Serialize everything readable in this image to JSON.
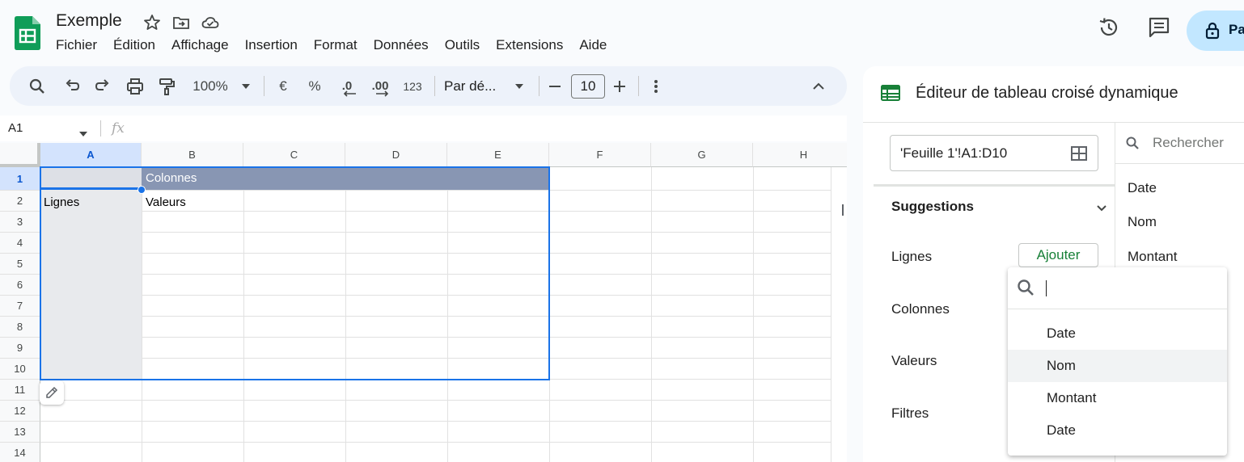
{
  "app": {
    "doc_title": "Exemple",
    "brand_color": "#0f9d58"
  },
  "menu": [
    "Fichier",
    "Édition",
    "Affichage",
    "Insertion",
    "Format",
    "Données",
    "Outils",
    "Extensions",
    "Aide"
  ],
  "header": {
    "share_label": "Pa"
  },
  "toolbar": {
    "zoom": "100%",
    "currency": "€",
    "percent": "%",
    "dec_decrease": ".0",
    "dec_increase": ".00",
    "number_format": "123",
    "font": "Par dé...",
    "font_size": "10"
  },
  "formula_bar": {
    "cell_ref": "A1",
    "fx": "fx",
    "value": ""
  },
  "grid": {
    "columns": [
      "A",
      "B",
      "C",
      "D",
      "E",
      "F",
      "G",
      "H"
    ],
    "rows": [
      "1",
      "2",
      "3",
      "4",
      "5",
      "6",
      "7",
      "8",
      "9",
      "10",
      "11",
      "12",
      "13",
      "14"
    ],
    "selected_column": "A",
    "selected_row": "1",
    "cells": {
      "B1": "Colonnes",
      "A2": "Lignes",
      "B2": "Valeurs"
    }
  },
  "panel": {
    "title": "Éditeur de tableau croisé dynamique",
    "range": "'Feuille 1'!A1:D10",
    "sections": {
      "suggestions": "Suggestions",
      "rows": "Lignes",
      "columns": "Colonnes",
      "values": "Valeurs",
      "filters": "Filtres"
    },
    "add_button": "Ajouter",
    "search_placeholder": "Rechercher",
    "fields": [
      "Date",
      "Nom",
      "Montant"
    ]
  },
  "dropdown": {
    "search_value": "",
    "items": [
      "Date",
      "Nom",
      "Montant",
      "Date"
    ],
    "hovered_index": 1
  }
}
